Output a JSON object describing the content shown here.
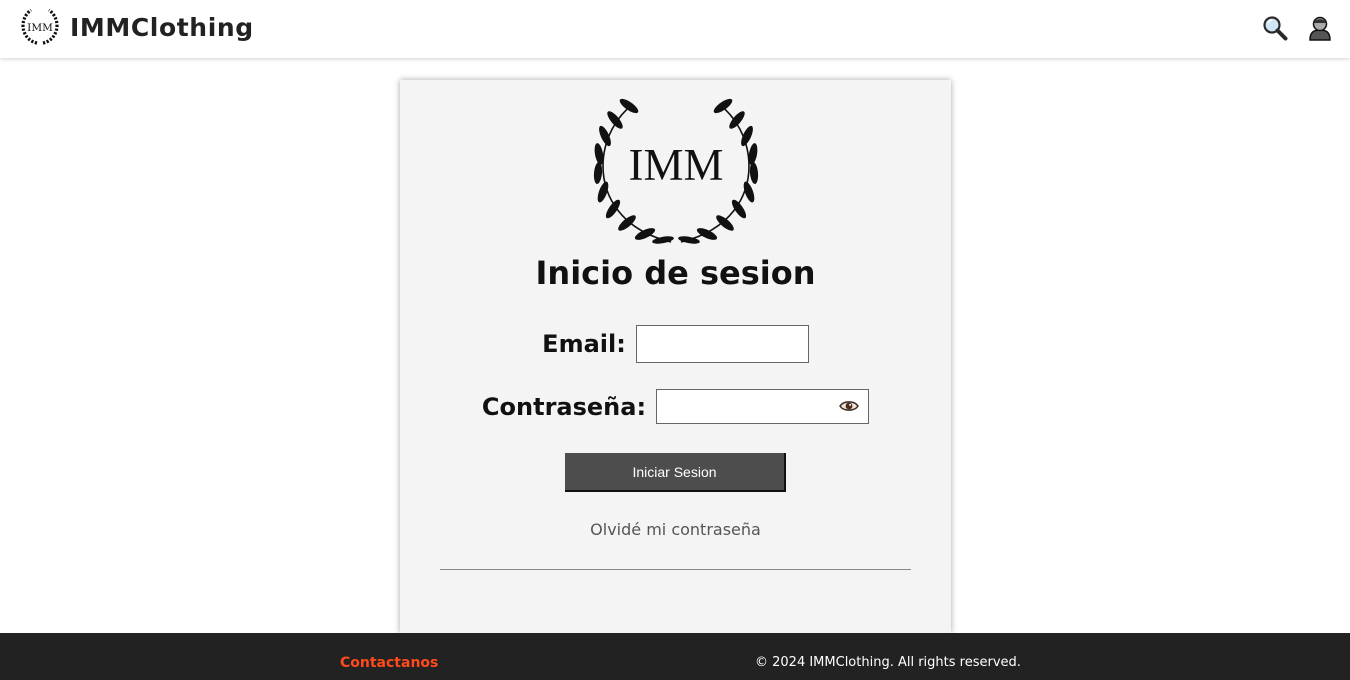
{
  "header": {
    "logo_text": "IMM",
    "brand_name": "IMMClothing",
    "icons": [
      "search-icon",
      "user-icon"
    ]
  },
  "login": {
    "logo_text": "IMM",
    "title": "Inicio de sesion",
    "email_label": "Email:",
    "email_value": "",
    "password_label": "Contraseña:",
    "password_value": "",
    "submit_label": "Iniciar Sesion",
    "forgot_label": "Olvidé mi contraseña"
  },
  "footer": {
    "contact_label": "Contactanos",
    "copyright": "© 2024 IMMClothing. All rights reserved."
  },
  "colors": {
    "submit_bg": "#4d4d4d",
    "footer_bg": "#222222",
    "contact_link": "#ff4a1c",
    "card_bg": "#f4f4f4"
  }
}
